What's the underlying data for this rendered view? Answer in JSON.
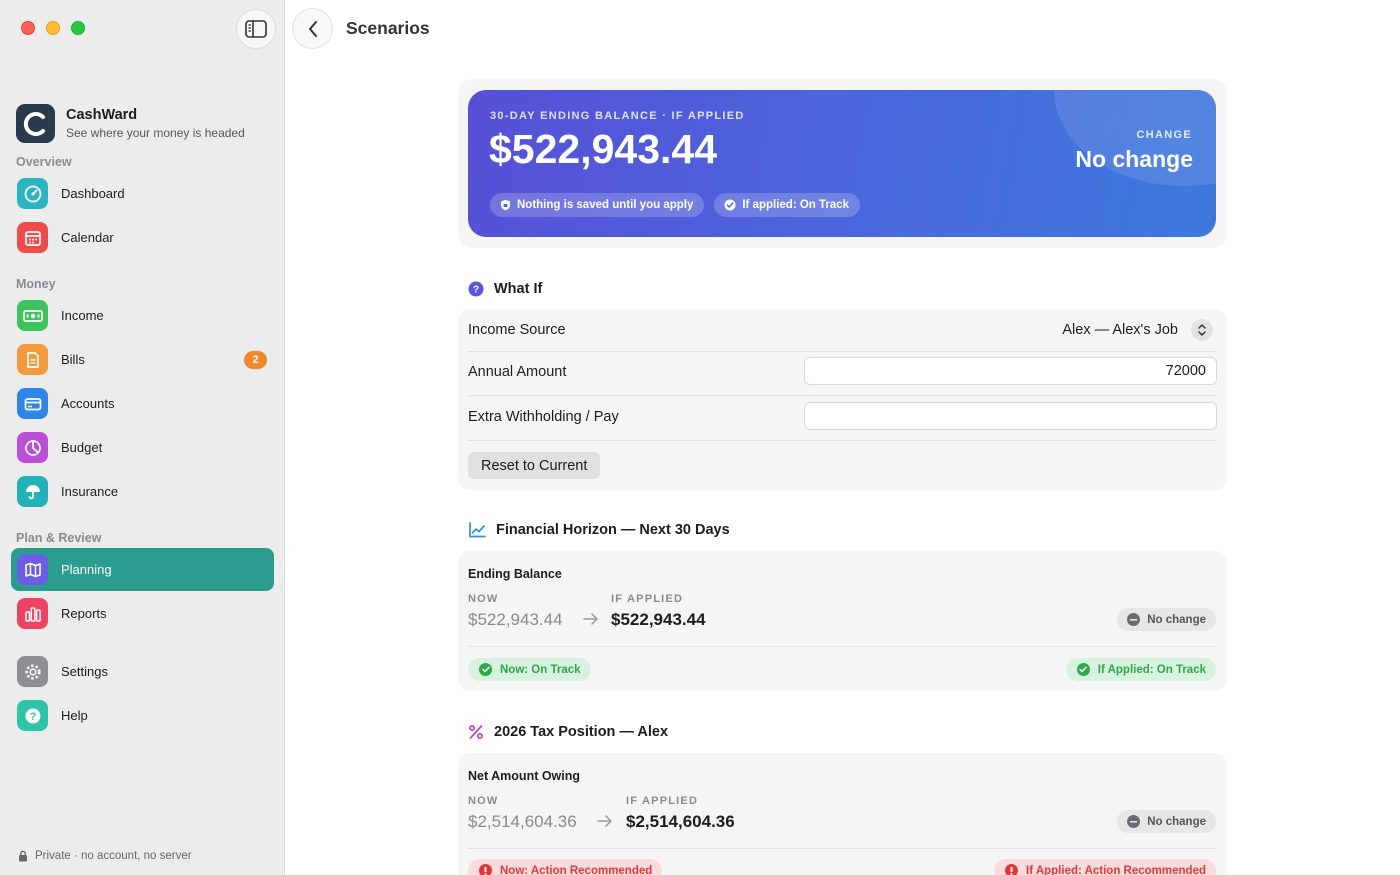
{
  "sidebar": {
    "brand": {
      "name": "CashWard",
      "tagline": "See where your money is headed"
    },
    "sections": {
      "overview": "Overview",
      "money": "Money",
      "plan": "Plan & Review"
    },
    "items": {
      "dashboard": "Dashboard",
      "calendar": "Calendar",
      "income": "Income",
      "bills": "Bills",
      "bills_badge": "2",
      "accounts": "Accounts",
      "budget": "Budget",
      "insurance": "Insurance",
      "planning": "Planning",
      "reports": "Reports",
      "settings": "Settings",
      "help": "Help"
    },
    "footer": "Private · no account, no server"
  },
  "header": {
    "title": "Scenarios"
  },
  "hero": {
    "kicker": "30-DAY ENDING BALANCE · IF APPLIED",
    "value": "$522,943.44",
    "pill_saved": "Nothing is saved until you apply",
    "pill_status": "If applied: On Track",
    "change_label": "CHANGE",
    "change_value": "No change"
  },
  "whatif": {
    "title": "What If",
    "income_source_label": "Income Source",
    "income_source_value": "Alex — Alex's Job",
    "annual_amount_label": "Annual Amount",
    "annual_amount_value": "72000",
    "extra_label": "Extra Withholding / Pay",
    "extra_value": "",
    "reset_label": "Reset to Current"
  },
  "horizon": {
    "title": "Financial Horizon — Next 30 Days",
    "metric": "Ending Balance",
    "now_label": "NOW",
    "now_value": "$522,943.44",
    "applied_label": "IF APPLIED",
    "applied_value": "$522,943.44",
    "change_chip": "No change",
    "now_status": "Now: On Track",
    "applied_status": "If Applied: On Track"
  },
  "tax": {
    "title": "2026 Tax Position — Alex",
    "metric": "Net Amount Owing",
    "now_label": "NOW",
    "now_value": "$2,514,604.36",
    "applied_label": "IF APPLIED",
    "applied_value": "$2,514,604.36",
    "change_chip": "No change",
    "now_status": "Now: Action Recommended",
    "applied_status": "If Applied: Action Recommended"
  },
  "colors": {
    "accent": "#2a9d8f",
    "hero_start": "#5650d6",
    "hero_end": "#3d79dd",
    "status_green": "#2ba84a",
    "status_red": "#e0393b",
    "badge_orange": "#f0892c"
  }
}
